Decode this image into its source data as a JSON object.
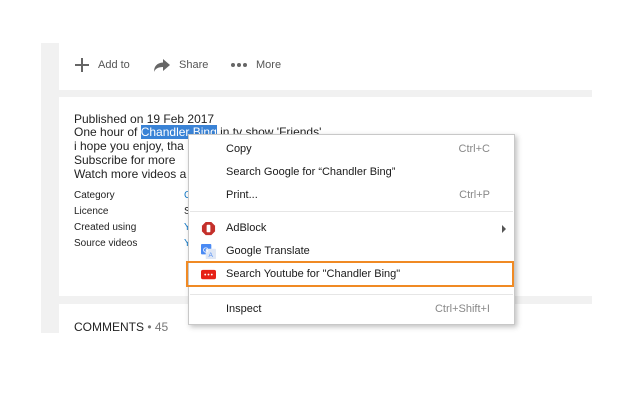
{
  "actions": {
    "add_to": "Add to",
    "share": "Share",
    "more": "More"
  },
  "description": {
    "published": "Published on 19 Feb 2017",
    "line1_before": "One hour of ",
    "line1_selected": "Chandler Bing",
    "line1_after": " in tv show 'Friends'",
    "line2": "i hope you enjoy, tha",
    "line3": "Subscribe for more",
    "line4": "Watch more videos a"
  },
  "meta": {
    "labels": [
      "Category",
      "Licence",
      "Created using",
      "Source videos"
    ],
    "values": [
      "C",
      "S",
      "Y",
      "Y"
    ]
  },
  "comments": {
    "label": "COMMENTS",
    "separator": " • ",
    "count": "45"
  },
  "context_menu": {
    "copy": "Copy",
    "copy_shortcut": "Ctrl+C",
    "search_google": "Search Google for “Chandler Bing”",
    "print": "Print...",
    "print_shortcut": "Ctrl+P",
    "adblock": "AdBlock",
    "google_translate": "Google Translate",
    "search_youtube": "Search Youtube for \"Chandler Bing\"",
    "inspect": "Inspect",
    "inspect_shortcut": "Ctrl+Shift+I"
  },
  "colors": {
    "selection": "#3a83d6",
    "highlight_box": "#f08a24",
    "youtube_red": "#e62117",
    "adblock_red": "#c4302b",
    "translate_blue": "#4a8af4"
  },
  "icons": [
    "plus-icon",
    "share-arrow-icon",
    "more-dots-icon",
    "adblock-icon",
    "google-translate-icon",
    "youtube-icon",
    "submenu-arrow-icon"
  ]
}
